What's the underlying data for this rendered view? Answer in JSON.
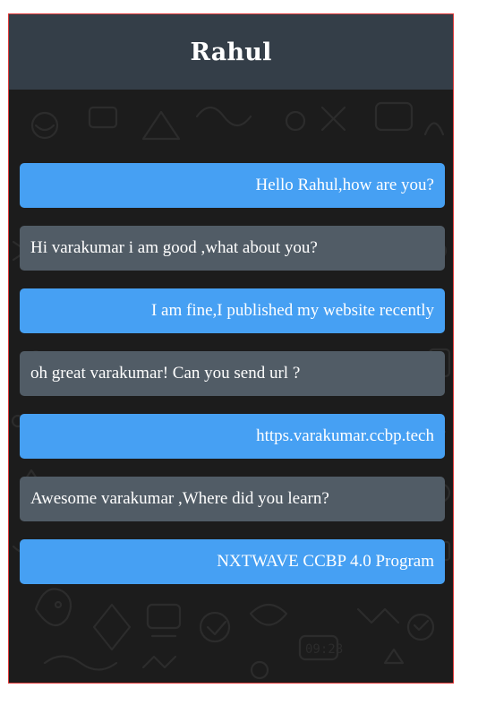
{
  "chat": {
    "contact_name": "Rahul"
  },
  "messages": [
    {
      "text": "Hello Rahul,how are you?",
      "direction": "sent"
    },
    {
      "text": "Hi varakumar i am good ,what about you?",
      "direction": "received"
    },
    {
      "text": "I am fine,I published my website recently",
      "direction": "sent"
    },
    {
      "text": "oh great varakumar! Can you send url ?",
      "direction": "received"
    },
    {
      "text": "https.varakumar.ccbp.tech",
      "direction": "sent"
    },
    {
      "text": "Awesome varakumar ,Where did you learn?",
      "direction": "received"
    },
    {
      "text": "NXTWAVE CCBP 4.0 Program",
      "direction": "sent"
    }
  ],
  "colors": {
    "header_bg": "#343e48",
    "sent_bubble": "#46a0f3",
    "received_bubble": "#515c66",
    "chat_background": "#1c1c1c",
    "frame_border": "#e03a3a"
  }
}
